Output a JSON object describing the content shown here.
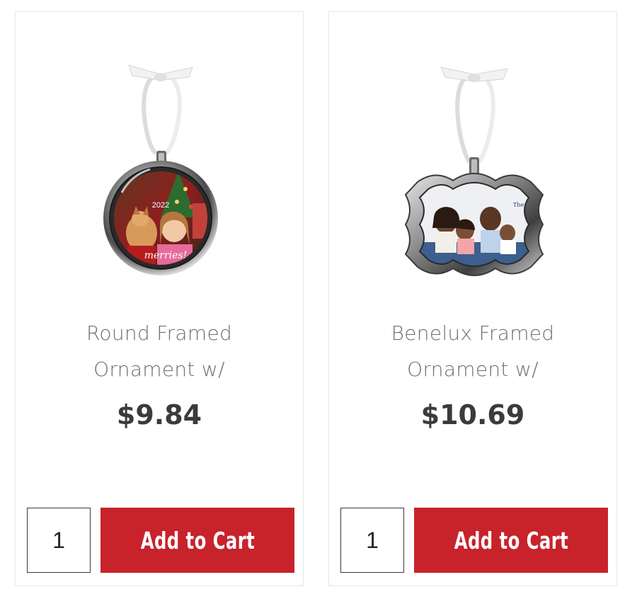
{
  "products": [
    {
      "name_line1": "Round Framed",
      "name_line2": "Ornament w/",
      "price": "$9.84",
      "photo_text": "merries!",
      "photo_year": "2022",
      "quantity": "1",
      "add_to_cart_label": "Add to Cart"
    },
    {
      "name_line1": "Benelux Framed",
      "name_line2": "Ornament w/",
      "price": "$10.69",
      "photo_text": "The Williams",
      "quantity": "1",
      "add_to_cart_label": "Add to Cart"
    }
  ],
  "colors": {
    "button": "#c8222b",
    "price_text": "#3b3b3b",
    "name_text": "#6f6f6f",
    "card_border": "#e6e6e6"
  }
}
